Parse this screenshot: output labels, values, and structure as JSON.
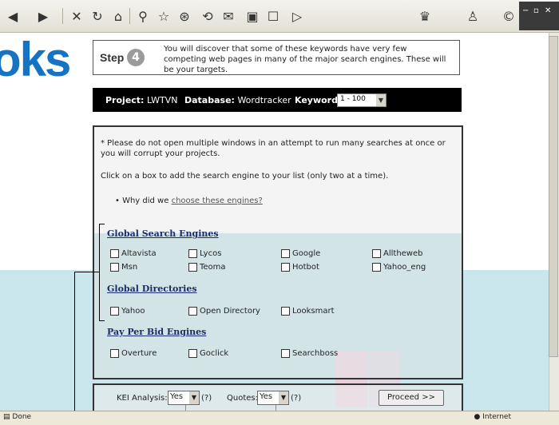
{
  "big_text": "oks",
  "step": {
    "label": "Step",
    "number": "4",
    "text": "You will discover that some of these keywords have very few competing web pages in many of the major search engines. These will be your targets."
  },
  "project_bar": {
    "project_label": "Project:",
    "project_value": "LWTVN",
    "database_label": "Database:",
    "database_value": "Wordtracker",
    "keywords_label": "Keywords:",
    "keywords_value": "1 - 100"
  },
  "main": {
    "notice": "* Please do not open multiple windows in an attempt to run many searches at once or you will corrupt your projects.",
    "click_note": "Click on a box to add the search engine to your list (only two at a time).",
    "why_text": "Why did we",
    "why_link": "choose these engines?",
    "global_search_title": "Global Search Engines",
    "global_search": [
      "Altavista",
      "Lycos",
      "Google",
      "Alltheweb",
      "Msn",
      "Teoma",
      "Hotbot",
      "Yahoo_eng"
    ],
    "global_dir_title": "Global Directories",
    "global_dir": [
      "Yahoo",
      "Open Directory",
      "Looksmart"
    ],
    "ppb_title": "Pay Per Bid Engines",
    "ppb": [
      "Overture",
      "Goclick",
      "Searchboss"
    ]
  },
  "bottom": {
    "kei_label": "KEI Analysis:",
    "kei_value": "Yes",
    "kei_help": "(?)",
    "quotes_label": "Quotes:",
    "quotes_value": "Yes",
    "quotes_help": "(?)",
    "proceed": "Proceed >>"
  },
  "status": {
    "left": "Done",
    "zone": "Internet"
  },
  "colors": {
    "big_text": "#1673c4",
    "overlay": "#c9e6ec",
    "section_title": "#1c2c6c"
  }
}
